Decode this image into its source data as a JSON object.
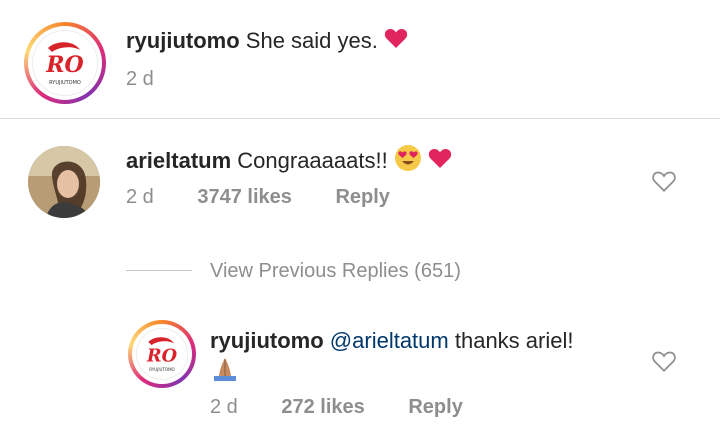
{
  "caption": {
    "username": "ryujiutomo",
    "text": "She said yes.",
    "time": "2 d",
    "avatar_text": "RO",
    "avatar_subtext": "RYUJIUTOMO"
  },
  "comment": {
    "username": "arieltatum",
    "text": "Congraaaaats!!",
    "time": "2 d",
    "likes": "3747 likes",
    "reply_label": "Reply"
  },
  "view_replies": "View Previous Replies (651)",
  "reply": {
    "username": "ryujiutomo",
    "mention": "@arieltatum",
    "text": "thanks ariel!",
    "time": "2 d",
    "likes": "272 likes",
    "reply_label": "Reply",
    "avatar_text": "RO",
    "avatar_subtext": "RYUJIUTOMO"
  },
  "colors": {
    "brand_red": "#d8232a",
    "heart_red": "#ed4956",
    "muted_gray": "#8e8e8e",
    "mention_blue": "#00376b"
  },
  "icons": [
    "red-heart-emoji-icon",
    "heart-eyes-emoji-icon",
    "praying-hands-emoji-icon",
    "like-heart-icon"
  ]
}
